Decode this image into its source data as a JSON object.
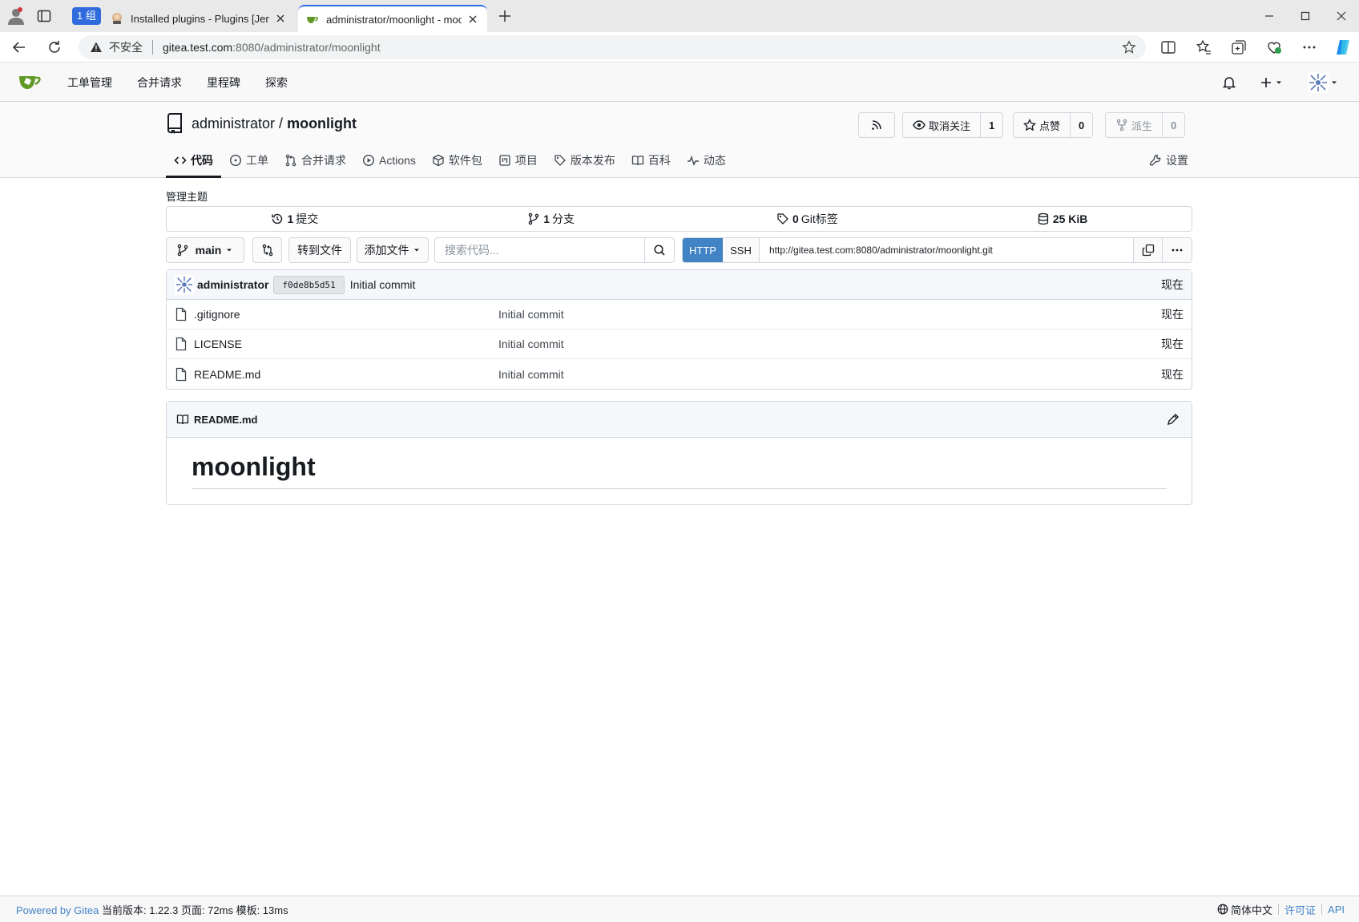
{
  "browser": {
    "tab_group_label": "1 组",
    "tabs": [
      {
        "title": "Installed plugins - Plugins [Jenkins]"
      },
      {
        "title": "administrator/moonlight - moonlight"
      }
    ],
    "address": {
      "security_label": "不安全",
      "url_host": "gitea.test.com",
      "url_path": ":8080/administrator/moonlight"
    },
    "colors": {
      "accent": "#2f6bdc",
      "warning_dot": "#d13438"
    }
  },
  "navbar": {
    "items": [
      {
        "label": "工单管理"
      },
      {
        "label": "合并请求"
      },
      {
        "label": "里程碑"
      },
      {
        "label": "探索"
      }
    ]
  },
  "repo": {
    "owner": "administrator",
    "separator": "/",
    "name": "moonlight",
    "unwatch": {
      "label": "取消关注",
      "count": "1"
    },
    "star": {
      "label": "点赞",
      "count": "0"
    },
    "fork": {
      "label": "派生",
      "count": "0"
    },
    "tabs": [
      {
        "label": "代码",
        "icon": "code-icon",
        "active": true
      },
      {
        "label": "工单",
        "icon": "issue-icon"
      },
      {
        "label": "合并请求",
        "icon": "pull-request-icon"
      },
      {
        "label": "Actions",
        "icon": "play-icon"
      },
      {
        "label": "软件包",
        "icon": "package-icon"
      },
      {
        "label": "项目",
        "icon": "project-icon"
      },
      {
        "label": "版本发布",
        "icon": "tag-icon"
      },
      {
        "label": "百科",
        "icon": "book-icon"
      },
      {
        "label": "动态",
        "icon": "pulse-icon"
      }
    ],
    "settings_label": "设置"
  },
  "content": {
    "topics_label": "管理主题",
    "stats": {
      "commits": {
        "count": "1",
        "label": "提交"
      },
      "branches": {
        "count": "1",
        "label": "分支"
      },
      "tags": {
        "count": "0",
        "label": "Git标签"
      },
      "size": {
        "value": "25 KiB"
      }
    },
    "toolbar": {
      "branch": "main",
      "go_to_file": "转到文件",
      "add_file": "添加文件",
      "search_placeholder": "搜索代码..."
    },
    "clone": {
      "http_label": "HTTP",
      "ssh_label": "SSH",
      "url": "http://gitea.test.com:8080/administrator/moonlight.git"
    },
    "last_commit": {
      "author": "administrator",
      "sha": "f0de8b5d51",
      "message": "Initial commit",
      "age": "现在"
    },
    "files": [
      {
        "name": ".gitignore",
        "message": "Initial commit",
        "age": "现在"
      },
      {
        "name": "LICENSE",
        "message": "Initial commit",
        "age": "现在"
      },
      {
        "name": "README.md",
        "message": "Initial commit",
        "age": "现在"
      }
    ],
    "readme": {
      "filename": "README.md",
      "heading": "moonlight"
    }
  },
  "footer": {
    "powered_by": "Powered by Gitea",
    "version_text": "当前版本: 1.22.3 页面: 72ms 模板: 13ms",
    "language": "简体中文",
    "license": "许可证",
    "api": "API"
  },
  "theme": {
    "link_color": "#4183c4",
    "http_button_color": "#4183c4",
    "gitea_green": "#609926"
  }
}
